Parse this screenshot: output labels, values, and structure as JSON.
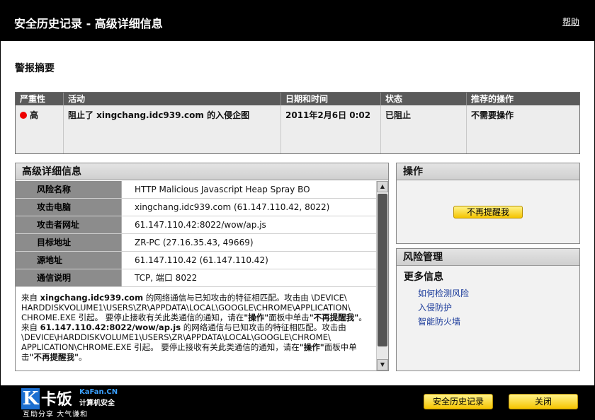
{
  "window": {
    "title": "安全历史记录 - 高级详细信息",
    "help_label": "帮助"
  },
  "summary": {
    "heading": "警报摘要",
    "columns": [
      "严重性",
      "活动",
      "日期和时间",
      "状态",
      "推荐的操作"
    ],
    "row": {
      "severity": "高",
      "activity": "阻止了 xingchang.idc939.com 的入侵企图",
      "datetime": "2011年2月6日 0:02",
      "status": "已阻止",
      "action": "不需要操作"
    },
    "severity_color": "#e00000"
  },
  "details": {
    "heading": "高级详细信息",
    "rows": [
      {
        "key": "风险名称",
        "value": "HTTP Malicious Javascript Heap Spray BO"
      },
      {
        "key": "攻击电脑",
        "value": "xingchang.idc939.com (61.147.110.42, 8022)"
      },
      {
        "key": "攻击者网址",
        "value": "61.147.110.42:8022/wow/ap.js"
      },
      {
        "key": "目标地址",
        "value": "ZR-PC (27.16.35.43, 49669)"
      },
      {
        "key": "源地址",
        "value": "61.147.110.42 (61.147.110.42)"
      },
      {
        "key": "通信说明",
        "value": "TCP, 端口 8022"
      }
    ],
    "description": {
      "p1": "来自 ",
      "b1": "xingchang.idc939.com",
      "p2": " 的网络通信与已知攻击的特征相匹配。攻击由 \\DEVICE\\ HARDDISKVOLUME1\\USERS\\ZR\\APPDATA\\LOCAL\\GOOGLE\\CHROME\\APPLICATION\\ CHROME.EXE 引起。 要停止接收有关此类通信的通知，请在",
      "b2": "\"操作\"",
      "p3": "面板中单击",
      "b3": "\"不再提醒我\"",
      "p4": "。 来自 ",
      "b4": "61.147.110.42:8022/wow/ap.js",
      "p5": " 的网络通信与已知攻击的特征相匹配。攻击由 \\DEVICE\\HARDDISKVOLUME1\\USERS\\ZR\\APPDATA\\LOCAL\\GOOGLE\\CHROME\\ APPLICATION\\CHROME.EXE 引起。 要停止接收有关此类通信的通知，请在",
      "b5": "\"操作\"",
      "p6": "面板中单击",
      "b6": "\"不再提醒我\"",
      "p7": "。"
    }
  },
  "operations": {
    "heading": "操作",
    "dont_remind_label": "不再提醒我"
  },
  "risk_management": {
    "heading": "风险管理",
    "more_info": "更多信息",
    "links": [
      "如何检测风险",
      "入侵防护",
      "智能防火墙"
    ]
  },
  "footer": {
    "logo": {
      "letter": "K",
      "name": "卡饭",
      "site": "KaFan.CN",
      "subtitle": "计算机安全",
      "tagline": "互助分享  大气谦和"
    },
    "history_label": "安全历史记录",
    "close_label": "关闭"
  },
  "colors": {
    "title_bg": "#000000",
    "accent_yellow": "#f5c400",
    "link_blue": "#1a3a9a"
  }
}
